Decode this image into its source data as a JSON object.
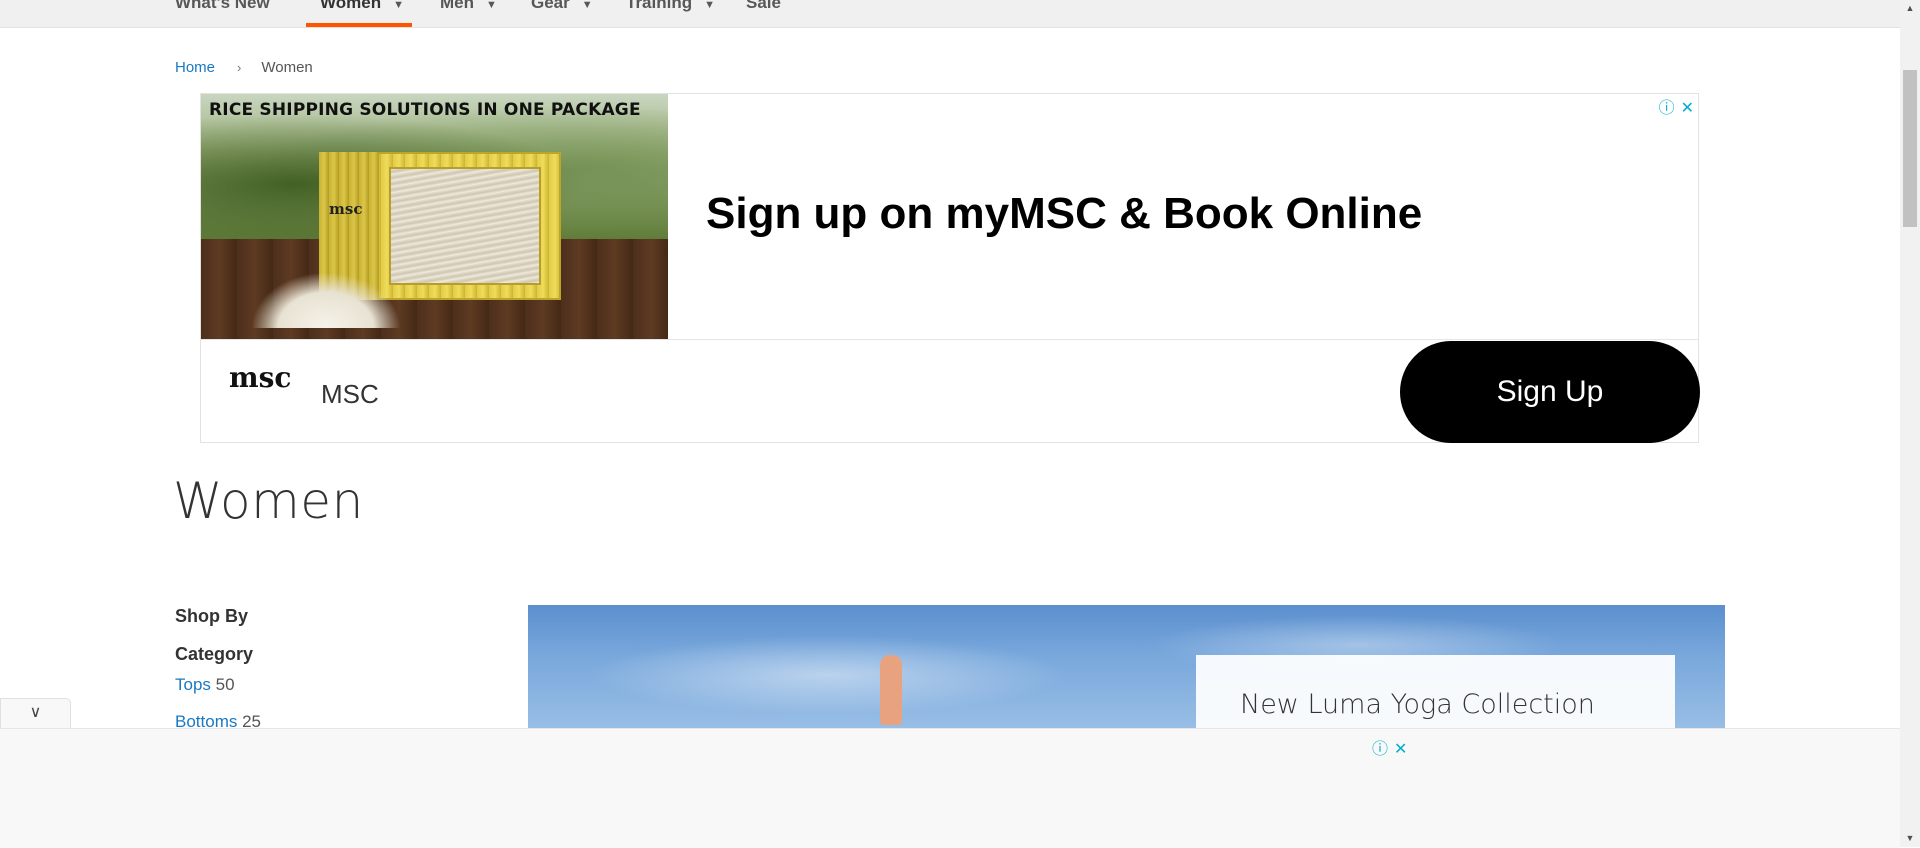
{
  "nav": {
    "items": [
      {
        "label": "What's New",
        "has_chevron": false
      },
      {
        "label": "Women",
        "has_chevron": true,
        "active": true
      },
      {
        "label": "Men",
        "has_chevron": true
      },
      {
        "label": "Gear",
        "has_chevron": true
      },
      {
        "label": "Training",
        "has_chevron": true
      },
      {
        "label": "Sale",
        "has_chevron": false
      }
    ],
    "chevron_icon": "chevron-down-icon",
    "active_color": "#ff5501"
  },
  "breadcrumb": {
    "home": "Home",
    "separator": "›",
    "current": "Women"
  },
  "ad": {
    "image_headline": "RICE SHIPPING SOLUTIONS IN ONE PACKAGE",
    "box_logo": "msc",
    "title": "Sign up on myMSC & Book Online",
    "brand_logo": "msc",
    "brand": "MSC",
    "cta": "Sign Up",
    "info_icon": "ⓘ",
    "close_icon": "✕",
    "accent": "#00aecd"
  },
  "page": {
    "title": "Women"
  },
  "sidebar": {
    "shop_by": "Shop By",
    "category_title": "Category",
    "categories": [
      {
        "label": "Tops",
        "count": "50"
      },
      {
        "label": "Bottoms",
        "count": "25"
      }
    ],
    "link_color": "#1979c3"
  },
  "hero": {
    "card_title": "New Luma Yoga Collection"
  },
  "sticky_ad": {
    "toggle_icon": "chevron-down-icon",
    "toggle_glyph": "∨",
    "info_icon": "ⓘ",
    "close_icon": "✕"
  },
  "scrollbar": {
    "up_glyph": "▲",
    "down_glyph": "▼"
  }
}
